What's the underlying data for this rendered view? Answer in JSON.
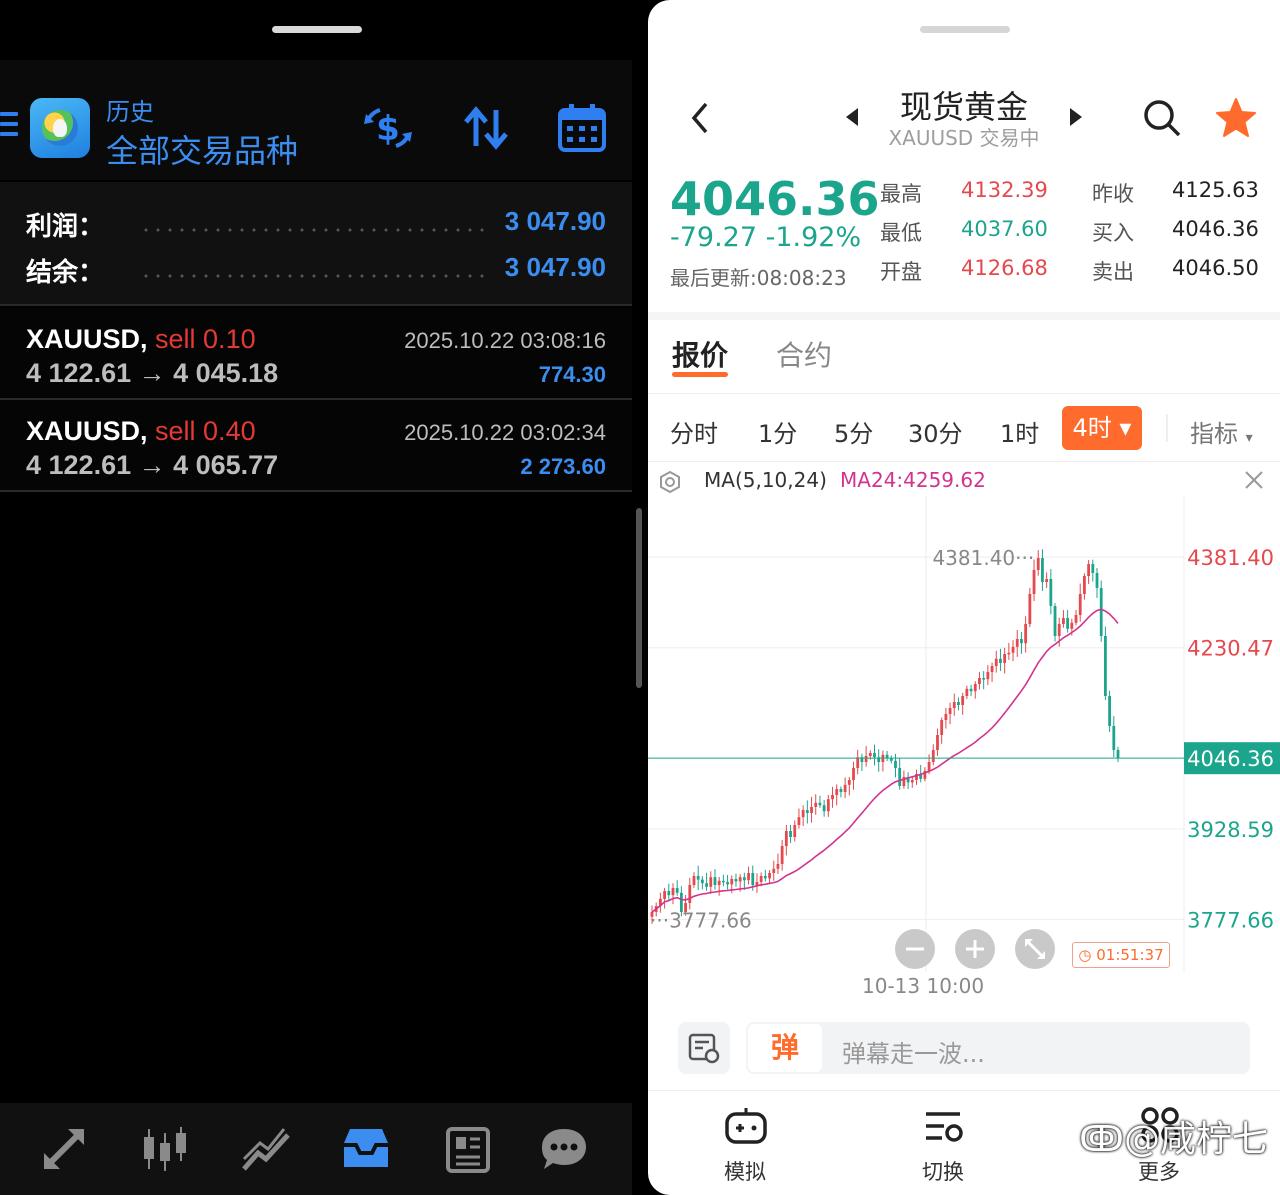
{
  "left": {
    "header": {
      "subtitle": "历史",
      "title": "全部交易品种"
    },
    "summary": {
      "profit_label": "利润：",
      "profit_value": "3 047.90",
      "balance_label": "结余：",
      "balance_value": "3 047.90"
    },
    "trades": [
      {
        "symbol": "XAUUSD,",
        "side": "sell 0.10",
        "prices": "4 122.61 → 4 045.18",
        "date": "2025.10.22 03:08:16",
        "pl": "774.30"
      },
      {
        "symbol": "XAUUSD,",
        "side": "sell 0.40",
        "prices": "4 122.61 → 4 065.77",
        "date": "2025.10.22 03:02:34",
        "pl": "2 273.60"
      }
    ],
    "toolbar_icons": [
      "menu-icon",
      "app-logo-icon",
      "currency-exchange-icon",
      "sort-icon",
      "calendar-icon"
    ],
    "bottom_nav_icons": [
      "trade-arrows-icon",
      "candlestick-icon",
      "line-chart-icon",
      "history-inbox-icon",
      "news-icon",
      "chat-icon"
    ],
    "accent": "#3b8ef0"
  },
  "right": {
    "header": {
      "title": "现货黄金",
      "subtitle": "XAUUSD 交易中"
    },
    "quote": {
      "price": "4046.36",
      "change": "-79.27  -1.92%",
      "updated": "最后更新:08:08:23",
      "stats": [
        {
          "label": "最高",
          "value": "4132.39"
        },
        {
          "label": "最低",
          "value": "4037.60"
        },
        {
          "label": "开盘",
          "value": "4126.68"
        },
        {
          "label": "昨收",
          "value": "4125.63"
        },
        {
          "label": "买入",
          "value": "4046.36"
        },
        {
          "label": "卖出",
          "value": "4046.50"
        }
      ]
    },
    "tabs": [
      "报价",
      "合约"
    ],
    "periods": [
      "分时",
      "1分",
      "5分",
      "30分",
      "1时",
      "4时",
      "指标"
    ],
    "active_period": "4时",
    "ma": {
      "label": "MA(5,10,24)",
      "value": "MA24:4259.62"
    },
    "countdown": "01:51:37",
    "time_label": "10-13 10:00",
    "danmu": {
      "badge": "弹",
      "placeholder": "弹幕走一波..."
    },
    "footer": [
      "模拟",
      "切换",
      "更多"
    ],
    "watermark": "@咸柠七",
    "colors": {
      "up": "#e5484d",
      "down": "#1ca58d",
      "accent": "#ff6b2c",
      "ma": "#d2338f"
    }
  },
  "chart_data": {
    "type": "candlestick",
    "y_ticks": [
      "4381.40",
      "4230.47",
      "4046.36",
      "3928.59",
      "3777.66"
    ],
    "y_tick_values": [
      4381.4,
      4230.47,
      4046.36,
      3928.59,
      3777.66
    ],
    "ylim": [
      3700,
      4450
    ],
    "high_annotation": "4381.40",
    "low_annotation": "3777.66",
    "current_price": 4046.36,
    "x_label": "10-13 10:00",
    "close": [
      3790,
      3800,
      3812,
      3825,
      3818,
      3830,
      3822,
      3790,
      3805,
      3835,
      3850,
      3844,
      3838,
      3832,
      3848,
      3835,
      3842,
      3840,
      3836,
      3845,
      3841,
      3848,
      3843,
      3855,
      3835,
      3840,
      3850,
      3846,
      3855,
      3862,
      3870,
      3900,
      3925,
      3915,
      3935,
      3948,
      3960,
      3955,
      3965,
      3972,
      3968,
      3958,
      3978,
      3985,
      3995,
      3990,
      4002,
      4010,
      4030,
      4048,
      4040,
      4050,
      4055,
      4048,
      4040,
      4052,
      4046,
      4042,
      4030,
      4000,
      4015,
      4006,
      4010,
      4020,
      4012,
      4025,
      4040,
      4060,
      4085,
      4110,
      4120,
      4130,
      4140,
      4135,
      4150,
      4162,
      4158,
      4170,
      4180,
      4178,
      4190,
      4200,
      4212,
      4205,
      4220,
      4222,
      4232,
      4245,
      4238,
      4270,
      4320,
      4360,
      4380,
      4340,
      4345,
      4300,
      4250,
      4270,
      4280,
      4262,
      4272,
      4285,
      4320,
      4350,
      4370,
      4355,
      4330,
      4250,
      4150,
      4100,
      4060,
      4046
    ]
  }
}
